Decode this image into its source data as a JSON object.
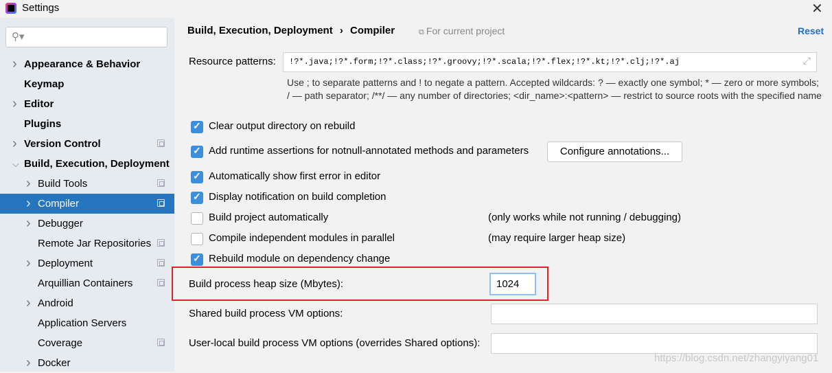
{
  "window": {
    "title": "Settings",
    "close": "✕"
  },
  "search": {
    "icon": "search-icon",
    "placeholder": ""
  },
  "sidebar": {
    "items": [
      {
        "label": "Appearance & Behavior",
        "level": 0,
        "arrow": true,
        "bold": true
      },
      {
        "label": "Keymap",
        "level": 0,
        "arrow": false,
        "bold": true
      },
      {
        "label": "Editor",
        "level": 0,
        "arrow": true,
        "bold": true
      },
      {
        "label": "Plugins",
        "level": 0,
        "arrow": false,
        "bold": true
      },
      {
        "label": "Version Control",
        "level": 0,
        "arrow": true,
        "bold": true,
        "copy": true
      },
      {
        "label": "Build, Execution, Deployment",
        "level": 0,
        "arrow": true,
        "expanded": true,
        "bold": true
      },
      {
        "label": "Build Tools",
        "level": 1,
        "arrow": true,
        "copy": true
      },
      {
        "label": "Compiler",
        "level": 1,
        "arrow": true,
        "copy": true,
        "selected": true
      },
      {
        "label": "Debugger",
        "level": 1,
        "arrow": true
      },
      {
        "label": "Remote Jar Repositories",
        "level": 1,
        "arrow": false,
        "copy": true
      },
      {
        "label": "Deployment",
        "level": 1,
        "arrow": true,
        "copy": true
      },
      {
        "label": "Arquillian Containers",
        "level": 1,
        "arrow": false,
        "copy": true
      },
      {
        "label": "Android",
        "level": 1,
        "arrow": true
      },
      {
        "label": "Application Servers",
        "level": 1,
        "arrow": false
      },
      {
        "label": "Coverage",
        "level": 1,
        "arrow": false,
        "copy": true
      },
      {
        "label": "Docker",
        "level": 1,
        "arrow": true
      }
    ]
  },
  "header": {
    "crumb1": "Build, Execution, Deployment",
    "sep": "›",
    "crumb2": "Compiler",
    "scope": "For current project",
    "reset": "Reset"
  },
  "resource": {
    "label": "Resource patterns:",
    "value": "!?*.java;!?*.form;!?*.class;!?*.groovy;!?*.scala;!?*.flex;!?*.kt;!?*.clj;!?*.aj",
    "help": "Use ; to separate patterns and ! to negate a pattern. Accepted wildcards: ? — exactly one symbol; * — zero or more symbols; / — path separator; /**/ — any number of directories;  <dir_name>:<pattern> — restrict to source roots with the specified name"
  },
  "options": [
    {
      "label": "Clear output directory on rebuild",
      "checked": true
    },
    {
      "label": "Add runtime assertions for notnull-annotated methods and parameters",
      "checked": true
    },
    {
      "label": "Automatically show first error in editor",
      "checked": true
    },
    {
      "label": "Display notification on build completion",
      "checked": true
    },
    {
      "label": "Build project automatically",
      "checked": false,
      "note": "(only works while not running / debugging)"
    },
    {
      "label": "Compile independent modules in parallel",
      "checked": false,
      "note": "(may require larger heap size)"
    },
    {
      "label": "Rebuild module on dependency change",
      "checked": true
    }
  ],
  "configure_button": "Configure annotations...",
  "heap": {
    "label": "Build process heap size (Mbytes):",
    "value": "1024"
  },
  "shared_vm": {
    "label": "Shared build process VM options:",
    "value": ""
  },
  "user_vm": {
    "label": "User-local build process VM options (overrides Shared options):",
    "value": ""
  },
  "watermark": "https://blog.csdn.net/zhangyiyang01",
  "colors": {
    "accent": "#2675bf",
    "checkbox": "#3d8fdc",
    "highlight_box": "#e0202a",
    "link": "#2470c2"
  }
}
